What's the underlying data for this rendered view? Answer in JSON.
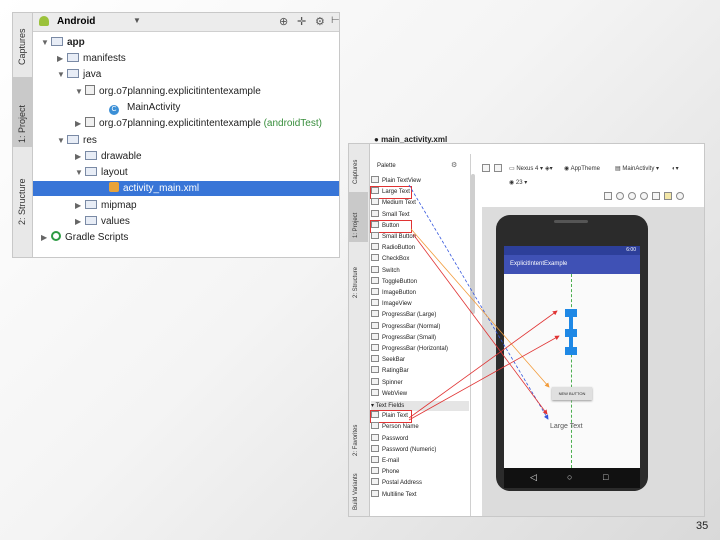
{
  "project_panel": {
    "view_selector": "Android",
    "side_tabs": [
      "Captures",
      "1: Project",
      "2: Structure"
    ],
    "tree": [
      {
        "label": "app",
        "depth": 0,
        "icon": "folder",
        "bold": true
      },
      {
        "label": "manifests",
        "depth": 1,
        "icon": "folder"
      },
      {
        "label": "java",
        "depth": 1,
        "icon": "folder"
      },
      {
        "label": "org.o7planning.explicitintentexample",
        "depth": 2,
        "icon": "package"
      },
      {
        "label": "MainActivity",
        "depth": 3,
        "icon": "class"
      },
      {
        "label": "org.o7planning.explicitintentexample",
        "suffix": "(androidTest)",
        "depth": 2,
        "icon": "package"
      },
      {
        "label": "res",
        "depth": 1,
        "icon": "folder"
      },
      {
        "label": "drawable",
        "depth": 2,
        "icon": "folder"
      },
      {
        "label": "layout",
        "depth": 2,
        "icon": "folder"
      },
      {
        "label": "activity_main.xml",
        "depth": 3,
        "icon": "xml",
        "selected": true
      },
      {
        "label": "mipmap",
        "depth": 2,
        "icon": "folder"
      },
      {
        "label": "values",
        "depth": 2,
        "icon": "folder"
      },
      {
        "label": "Gradle Scripts",
        "depth": 0,
        "icon": "gradle"
      }
    ]
  },
  "designer": {
    "file_tab": "main_activity.xml",
    "side_tabs": [
      "Captures",
      "1: Project",
      "2: Structure",
      "2: Favorites",
      "Build Variants"
    ],
    "palette_title": "Palette",
    "palette_items": [
      {
        "label": "Plain TextView"
      },
      {
        "label": "Large Text",
        "highlight": true
      },
      {
        "label": "Medium Text"
      },
      {
        "label": "Small Text"
      },
      {
        "label": "Button",
        "highlight": true
      },
      {
        "label": "Small Button"
      },
      {
        "label": "RadioButton"
      },
      {
        "label": "CheckBox"
      },
      {
        "label": "Switch"
      },
      {
        "label": "ToggleButton"
      },
      {
        "label": "ImageButton"
      },
      {
        "label": "ImageView"
      },
      {
        "label": "ProgressBar (Large)"
      },
      {
        "label": "ProgressBar (Normal)"
      },
      {
        "label": "ProgressBar (Small)"
      },
      {
        "label": "ProgressBar (Horizontal)"
      },
      {
        "label": "SeekBar"
      },
      {
        "label": "RatingBar"
      },
      {
        "label": "Spinner"
      },
      {
        "label": "WebView"
      },
      {
        "label": "Text Fields",
        "category": true
      },
      {
        "label": "Plain Text",
        "highlight": true
      },
      {
        "label": "Person Name"
      },
      {
        "label": "Password"
      },
      {
        "label": "Password (Numeric)"
      },
      {
        "label": "E-mail"
      },
      {
        "label": "Phone"
      },
      {
        "label": "Postal Address"
      },
      {
        "label": "Multiline Text"
      }
    ],
    "toolbar": {
      "device": "Nexus 4",
      "theme": "AppTheme",
      "activity": "MainActivity",
      "api": "23"
    },
    "phone": {
      "time": "6:00",
      "app_title": "ExplicitIntentExample",
      "button_label": "NEW BUTTON",
      "large_text": "Large Text"
    }
  },
  "page_number": "35"
}
